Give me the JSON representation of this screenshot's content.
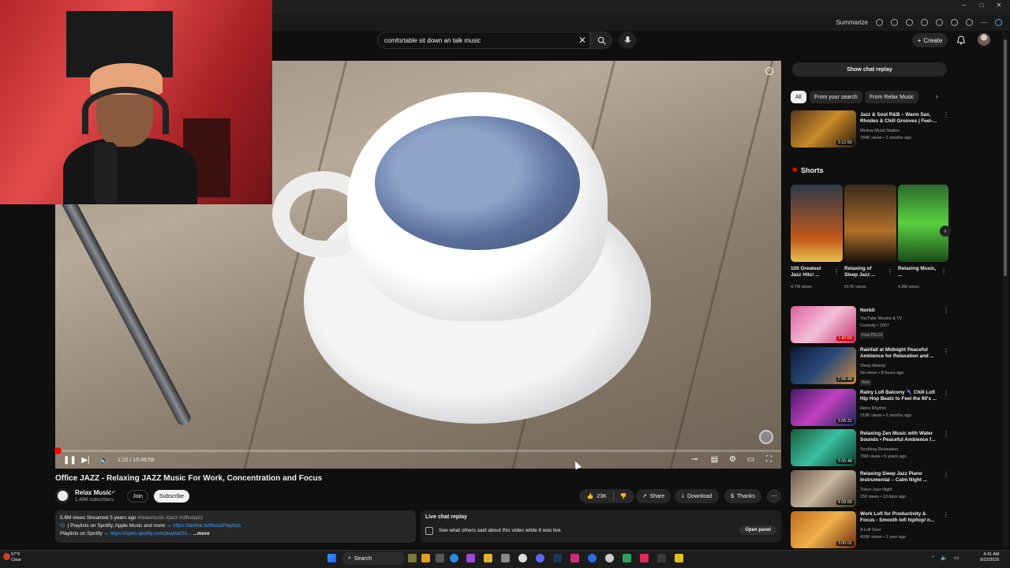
{
  "browser": {
    "summarize_label": "Summarize"
  },
  "header": {
    "search_value": "comfortable sit down an talk music",
    "create_label": "Create"
  },
  "video": {
    "title": "Office JAZZ - Relaxing JAZZ Music For Work, Concentration and Focus",
    "time": "1:22 / 10:46:58",
    "progress_fraction": 0.0021
  },
  "channel": {
    "name": "Relax Music",
    "subscribers": "1.49M subscribers",
    "join_label": "Join",
    "subscribe_label": "Subscribe"
  },
  "actions": {
    "likes": "23K",
    "share_label": "Share",
    "download_label": "Download",
    "thanks_label": "Thanks"
  },
  "description": {
    "stats": "5.6M views  Streamed 5 years ago",
    "tags": "#relaxmusic #jazz #officejazz",
    "line2_text": "🎼 | Playlists on Spotify, Apple Music and more →",
    "line2_link": "https://fanlink.tv/MusicPlaylists",
    "line3_text": "Playlists on Spotify →",
    "line3_link": "https://open.spotify.com/playlist/2X...",
    "more_label": "...more"
  },
  "live_chat": {
    "title": "Live chat replay",
    "text": "See what others said about this video while it was live.",
    "open_label": "Open panel"
  },
  "sidebar": {
    "show_chat_label": "Show chat replay",
    "chips": [
      "All",
      "From your search",
      "From Relax Music"
    ],
    "shorts_label": "Shorts",
    "recs": [
      {
        "title": "Jazz & Soul R&B – Warm Sax, Rhodes & Chill Grooves | Feel-...",
        "channel": "Mellow Mood Station",
        "meta": "784K views • 2 months ago",
        "duration": "3:12:50"
      },
      {
        "title": "Norbit",
        "channel": "YouTube Movies & TV",
        "meta": "Comedy • 2007",
        "duration": "1:42:03",
        "badge": "Free  PG-13"
      },
      {
        "title": "Rainfall at Midnight Peaceful Ambience for Relaxation and ...",
        "channel": "Sleep Melody",
        "meta": "No views • 8 hours ago",
        "duration": "2:56:48",
        "badge": "New"
      },
      {
        "title": "Rainy Lofi Balcony 🌂 Chill Lofi Hip Hop Beats to Feel the 90's ...",
        "channel": "Retro Rhythm",
        "meta": "210K views • 2 months ago",
        "duration": "3:05:31"
      },
      {
        "title": "Relaxing Zen Music with Water Sounds • Peaceful Ambience f...",
        "channel": "Soothing Relaxation",
        "meta": "76M views • 5 years ago",
        "duration": "3:05:48"
      },
      {
        "title": "Relaxing Sleep Jazz Piano Instrumental – Calm Night ...",
        "channel": "Tokyo Jazz Night",
        "meta": "159 views • 13 days ago",
        "duration": "4:09:59"
      },
      {
        "title": "Work Lofi for Productivity & Focus - Smooth lofi hiphop/ n...",
        "channel": "A Lofi Soul",
        "meta": "426K views • 1 year ago",
        "duration": "3:00:01"
      }
    ],
    "shorts": [
      {
        "title": "100 Greatest Jazz Hits! ...",
        "views": "4.7M views"
      },
      {
        "title": "Relaxing of Sleep Jazz ...",
        "views": "517K views"
      },
      {
        "title": "Relaxing Music, ...",
        "views": "4.8M views"
      }
    ]
  },
  "taskbar": {
    "weather_temp": "67°F",
    "weather_text": "Clear",
    "search_label": "Search",
    "time": "4:41 AM",
    "date": "9/22/2025"
  },
  "colors": {
    "background": "#0f0f0f",
    "accent_red": "#ff0000",
    "link_blue": "#3ea6ff"
  }
}
